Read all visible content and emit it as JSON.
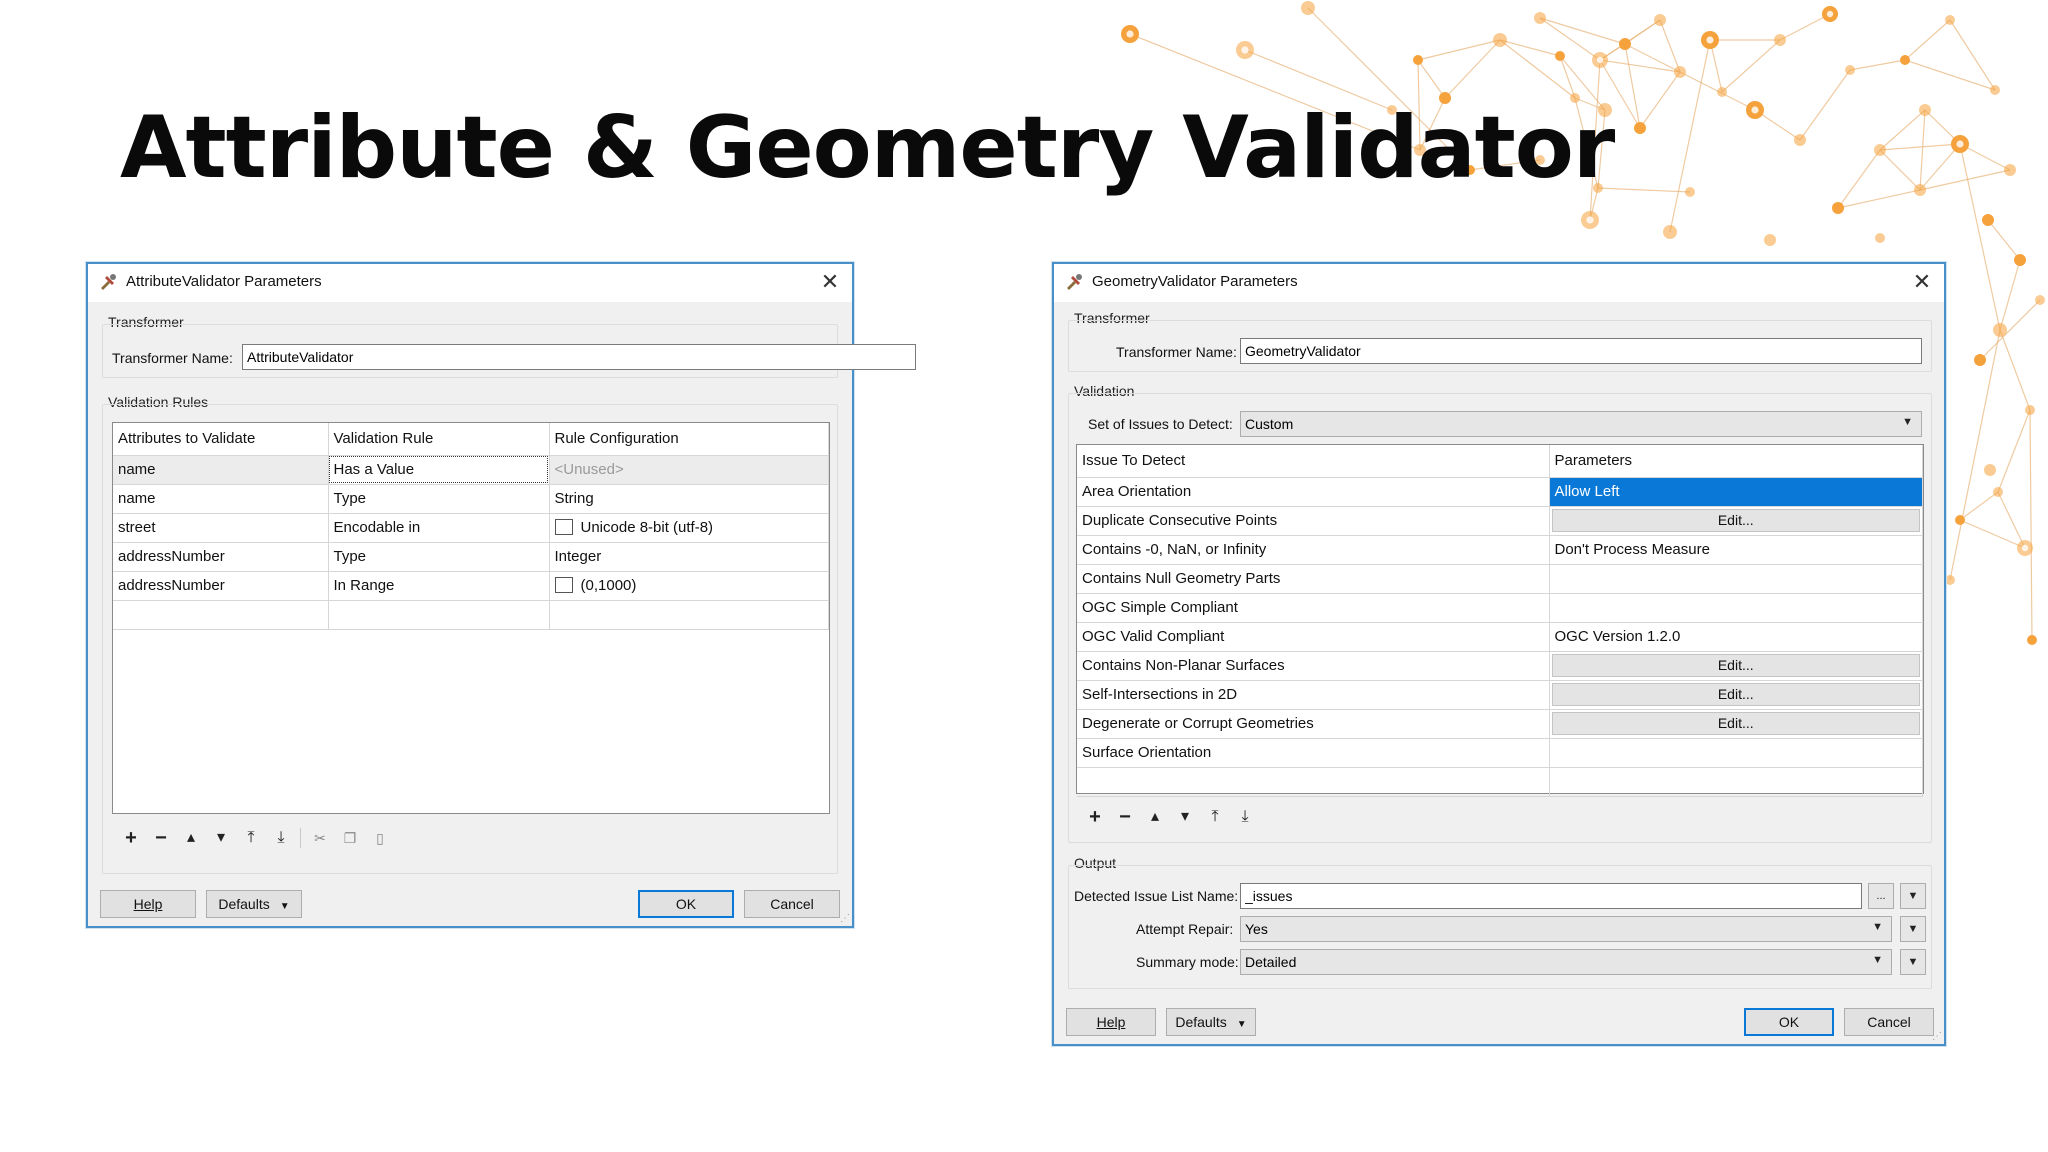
{
  "slide": {
    "title": "Attribute & Geometry Validator",
    "accent_color": "#f5a23c"
  },
  "attr_dialog": {
    "title": "AttributeValidator Parameters",
    "transformer_group": "Transformer",
    "transformer_name_label": "Transformer Name:",
    "transformer_name_value": "AttributeValidator",
    "rules_group": "Validation Rules",
    "columns": [
      "Attributes to Validate",
      "Validation Rule",
      "Rule Configuration"
    ],
    "rows": [
      {
        "attribute": "name",
        "rule": "Has a Value",
        "config": "<Unused>",
        "checkbox": false
      },
      {
        "attribute": "name",
        "rule": "Type",
        "config": "String",
        "checkbox": false
      },
      {
        "attribute": "street",
        "rule": "Encodable in",
        "config": "Unicode 8-bit (utf-8)",
        "checkbox": true
      },
      {
        "attribute": "addressNumber",
        "rule": "Type",
        "config": "Integer",
        "checkbox": false
      },
      {
        "attribute": "addressNumber",
        "rule": "In Range",
        "config": "(0,1000)",
        "checkbox": true
      }
    ],
    "help": "Help",
    "defaults": "Defaults",
    "ok": "OK",
    "cancel": "Cancel"
  },
  "geom_dialog": {
    "title": "GeometryValidator Parameters",
    "transformer_group": "Transformer",
    "transformer_name_label": "Transformer Name:",
    "transformer_name_value": "GeometryValidator",
    "validation_group": "Validation",
    "issues_label": "Set of Issues to Detect:",
    "issues_value": "Custom",
    "columns": [
      "Issue To Detect",
      "Parameters"
    ],
    "rows": [
      {
        "issue": "Area Orientation",
        "param": "Allow Left",
        "kind": "selected"
      },
      {
        "issue": "Duplicate Consecutive Points",
        "param": "Edit...",
        "kind": "button"
      },
      {
        "issue": "Contains -0, NaN, or Infinity",
        "param": "Don't Process Measure",
        "kind": "text"
      },
      {
        "issue": "Contains Null Geometry Parts",
        "param": "",
        "kind": "text"
      },
      {
        "issue": "OGC Simple Compliant",
        "param": "",
        "kind": "text"
      },
      {
        "issue": "OGC Valid Compliant",
        "param": "OGC Version 1.2.0",
        "kind": "text"
      },
      {
        "issue": "Contains Non-Planar Surfaces",
        "param": "Edit...",
        "kind": "button"
      },
      {
        "issue": "Self-Intersections in 2D",
        "param": "Edit...",
        "kind": "button"
      },
      {
        "issue": "Degenerate or Corrupt Geometries",
        "param": "Edit...",
        "kind": "button"
      },
      {
        "issue": "Surface Orientation",
        "param": "",
        "kind": "text"
      }
    ],
    "output_group": "Output",
    "issue_list_label": "Detected Issue List Name:",
    "issue_list_value": "_issues",
    "ellipsis": "...",
    "repair_label": "Attempt Repair:",
    "repair_value": "Yes",
    "summary_label": "Summary mode:",
    "summary_value": "Detailed",
    "help": "Help",
    "defaults": "Defaults",
    "ok": "OK",
    "cancel": "Cancel"
  }
}
